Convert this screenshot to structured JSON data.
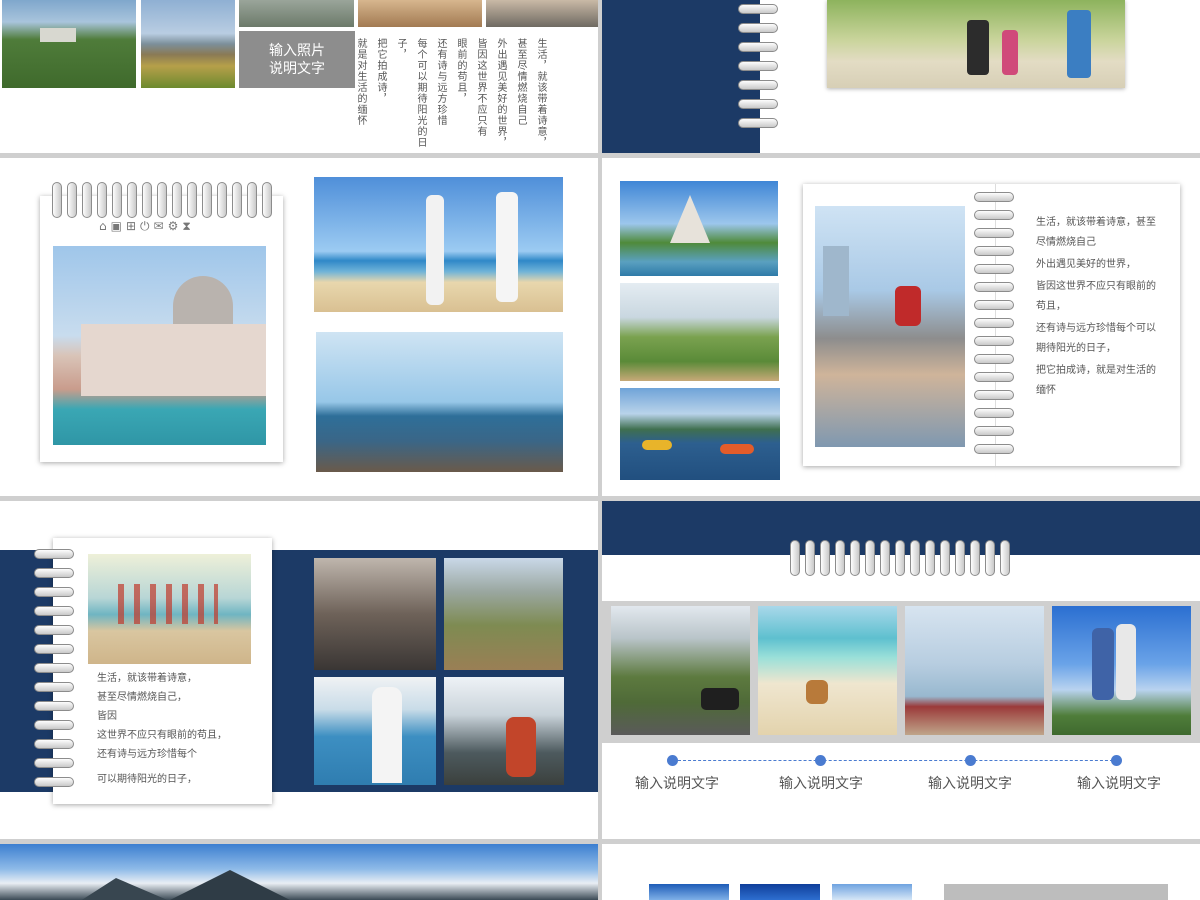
{
  "slide1": {
    "caption_line1": "输入照片",
    "caption_line2": "说明文字",
    "vertical_lines": [
      "生活，就该带着诗意，",
      "甚至尽情燃烧自己",
      "外出遇见美好的世界，",
      "皆因这世界不应只有",
      "眼前的苟且，",
      "还有诗与远方珍惜",
      "每个可以期待阳光的日子，",
      "把它拍成诗，",
      "就是对生活的缅怀"
    ]
  },
  "slide3": {
    "toolbar_icons": [
      "home-icon",
      "shopping-bag-icon",
      "gift-icon",
      "power-icon",
      "mail-icon",
      "gear-icon",
      "hourglass-icon"
    ]
  },
  "slide4": {
    "lines": [
      "生活，就该带着诗意，甚至",
      "尽情燃烧自己",
      "外出遇见美好的世界，",
      "皆因这世界不应只有眼前的",
      "苟且，",
      "还有诗与远方珍惜每个可以",
      "期待阳光的日子，",
      "把它拍成诗，就是对生活的",
      "缅怀"
    ]
  },
  "slide5": {
    "lines": [
      "生活，就该带着诗意，",
      "甚至尽情燃烧自己，",
      "皆因",
      "这世界不应只有眼前的苟且，",
      "还有诗与远方珍惜每个",
      "可以期待阳光的日子，"
    ]
  },
  "slide6": {
    "captions": [
      "输入说明文字",
      "输入说明文字",
      "输入说明文字",
      "输入说明文字"
    ]
  }
}
